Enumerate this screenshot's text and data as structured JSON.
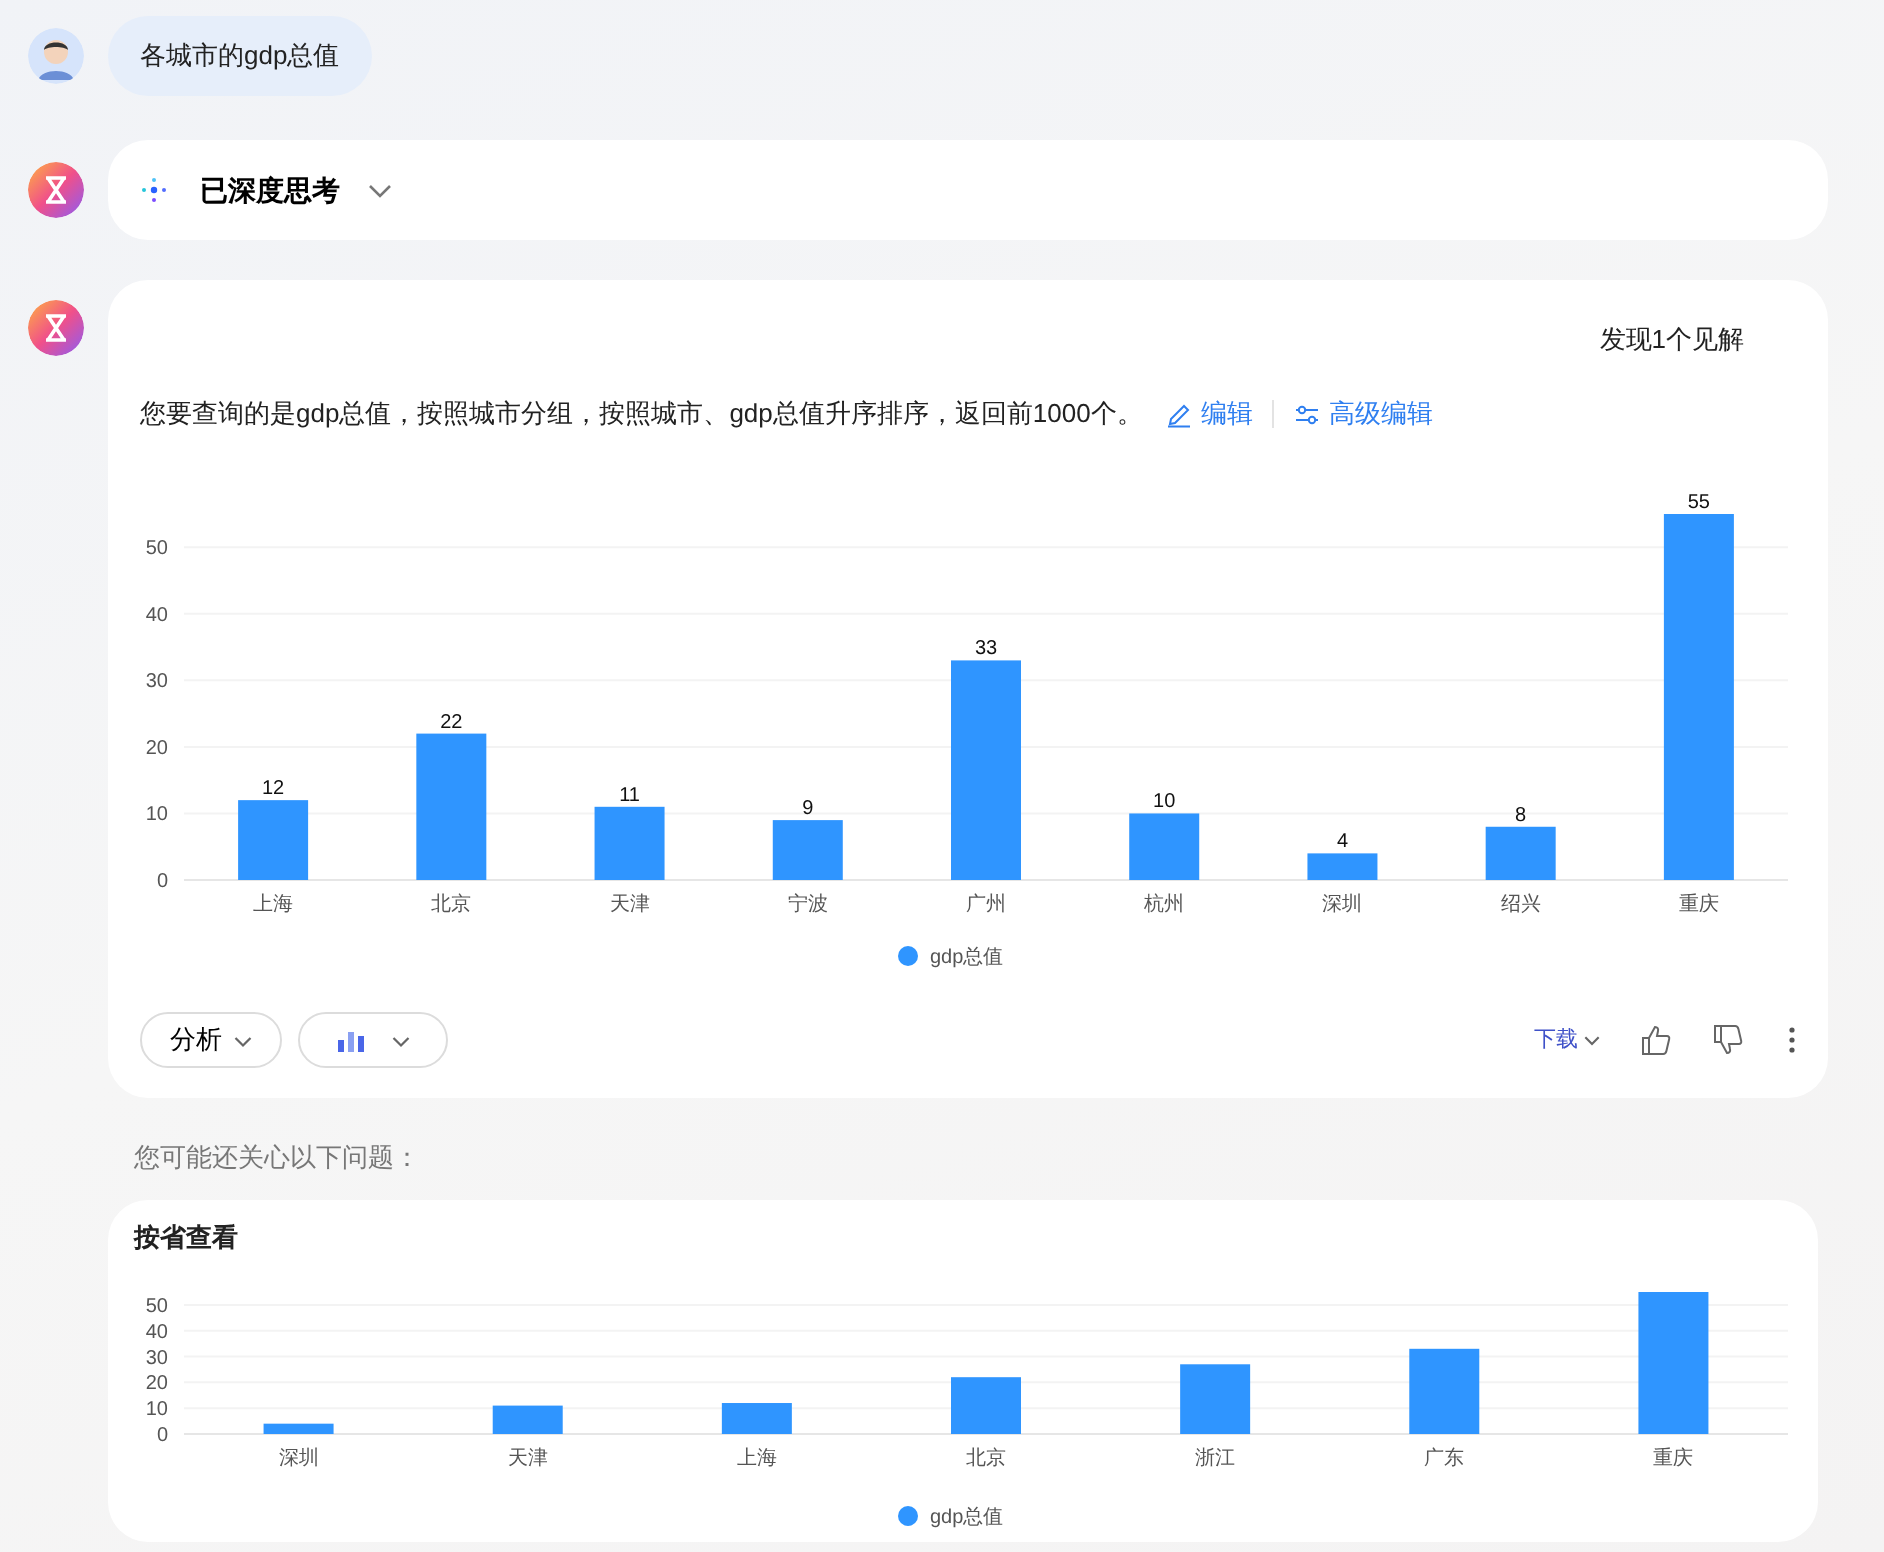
{
  "user_message": {
    "text": "各城市的gdp总值"
  },
  "thinking": {
    "label": "已深度思考",
    "expanded": false
  },
  "answer": {
    "insight": "发现1个见解",
    "description": "您要查询的是gdp总值，按照城市分组，按照城市、gdp总值升序排序，返回前1000个。",
    "actions": [
      {
        "kind": "edit",
        "label": "编辑"
      },
      {
        "kind": "advanced",
        "label": "高级编辑"
      }
    ],
    "chart_data": {
      "type": "bar",
      "categories": [
        "上海",
        "北京",
        "天津",
        "宁波",
        "广州",
        "杭州",
        "深圳",
        "绍兴",
        "重庆"
      ],
      "series": [
        {
          "name": "gdp总值",
          "color": "#2f95ff",
          "values": [
            12,
            22,
            11,
            9,
            33,
            10,
            4,
            8,
            55
          ]
        }
      ],
      "ylim": [
        0,
        55
      ],
      "yticks": [
        0,
        10,
        20,
        30,
        40,
        50
      ],
      "grid": true,
      "data_labels": true
    },
    "analyze_label": "分析",
    "download_label": "下载"
  },
  "suggestions_title": "您可能还关心以下问题：",
  "suggestion": {
    "title": "按省查看",
    "chart_data": {
      "type": "bar",
      "categories": [
        "深圳",
        "天津",
        "上海",
        "北京",
        "浙江",
        "广东",
        "重庆"
      ],
      "series": [
        {
          "name": "gdp总值",
          "color": "#2f95ff",
          "values": [
            4,
            11,
            12,
            22,
            27,
            33,
            55
          ]
        }
      ],
      "ylim": [
        0,
        55
      ],
      "yticks": [
        0,
        10,
        20,
        30,
        40,
        50
      ],
      "grid": true
    }
  }
}
